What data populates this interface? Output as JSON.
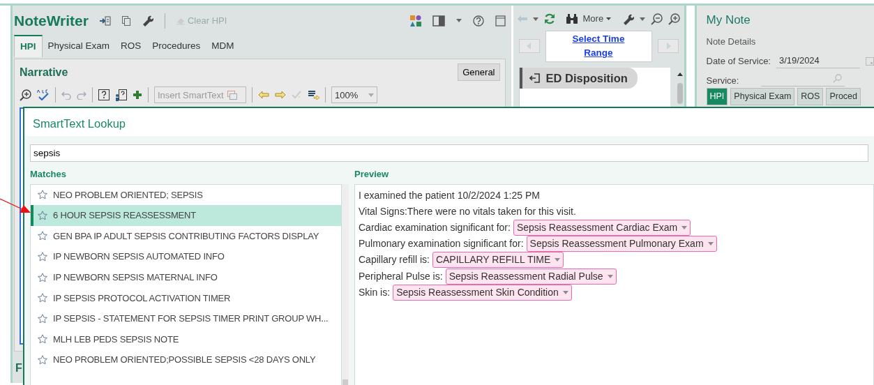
{
  "notewriter": {
    "title": "NoteWriter",
    "clear_button": "Clear HPI",
    "tabs": [
      {
        "label": "HPI",
        "selected": true
      },
      {
        "label": "Physical Exam",
        "selected": false
      },
      {
        "label": "ROS",
        "selected": false
      },
      {
        "label": "Procedures",
        "selected": false
      },
      {
        "label": "MDM",
        "selected": false
      }
    ],
    "narrative": {
      "title": "Narrative",
      "general_button": "General",
      "insert_field": {
        "placeholder": "Insert SmartText"
      },
      "zoom": "100%",
      "lower_section_label": "F"
    }
  },
  "timeline": {
    "more_button": "More",
    "time_range_link": "Select Time Range",
    "section": "ED Disposition"
  },
  "my_note": {
    "title": "My Note",
    "section": "Note Details",
    "date_label": "Date of Service:",
    "date_value": "3/19/2024",
    "service_label": "Service:",
    "tabs": [
      {
        "label": "HPI",
        "selected": true
      },
      {
        "label": "Physical Exam",
        "selected": false
      },
      {
        "label": "ROS",
        "selected": false
      },
      {
        "label": "Proced",
        "selected": false
      }
    ]
  },
  "smarttext_lookup": {
    "title": "SmartText Lookup",
    "search": {
      "value": "sepsis"
    },
    "matches_label": "Matches",
    "matches": [
      {
        "label": "NEO PROBLEM ORIENTED; SEPSIS",
        "selected": false
      },
      {
        "label": "6 HOUR SEPSIS REASSESSMENT",
        "selected": true
      },
      {
        "label": "GEN BPA IP ADULT SEPSIS CONTRIBUTING FACTORS DISPLAY",
        "selected": false
      },
      {
        "label": "IP NEWBORN SEPSIS AUTOMATED INFO",
        "selected": false
      },
      {
        "label": "IP NEWBORN SEPSIS MATERNAL INFO",
        "selected": false
      },
      {
        "label": "IP SEPSIS PROTOCOL ACTIVATION TIMER",
        "selected": false
      },
      {
        "label": "IP SEPSIS - STATEMENT FOR SEPSIS TIMER PRINT GROUP WH...",
        "selected": false
      },
      {
        "label": "MLH LEB PEDS SEPSIS NOTE",
        "selected": false
      },
      {
        "label": "NEO PROBLEM ORIENTED;POSSIBLE SEPSIS <28 DAYS ONLY",
        "selected": false
      }
    ],
    "preview_label": "Preview",
    "preview": [
      {
        "text": "I examined the patient 10/2/2024 1:25 PM"
      },
      {
        "text": "Vital Signs:There were no vitals taken for this visit."
      },
      {
        "text": "Cardiac examination significant for:",
        "field": "Sepsis Reassessment Cardiac Exam"
      },
      {
        "text": "Pulmonary examination significant for:",
        "field": "Sepsis Reassessment Pulmonary Exam"
      },
      {
        "text": "Capillary refill is:",
        "field": "CAPILLARY REFILL TIME"
      },
      {
        "text": "Peripheral Pulse is:",
        "field": "Sepsis Reassessment Radial Pulse"
      },
      {
        "text": "Skin is:",
        "field": "Sepsis Reassessment Skin Condition"
      }
    ]
  }
}
